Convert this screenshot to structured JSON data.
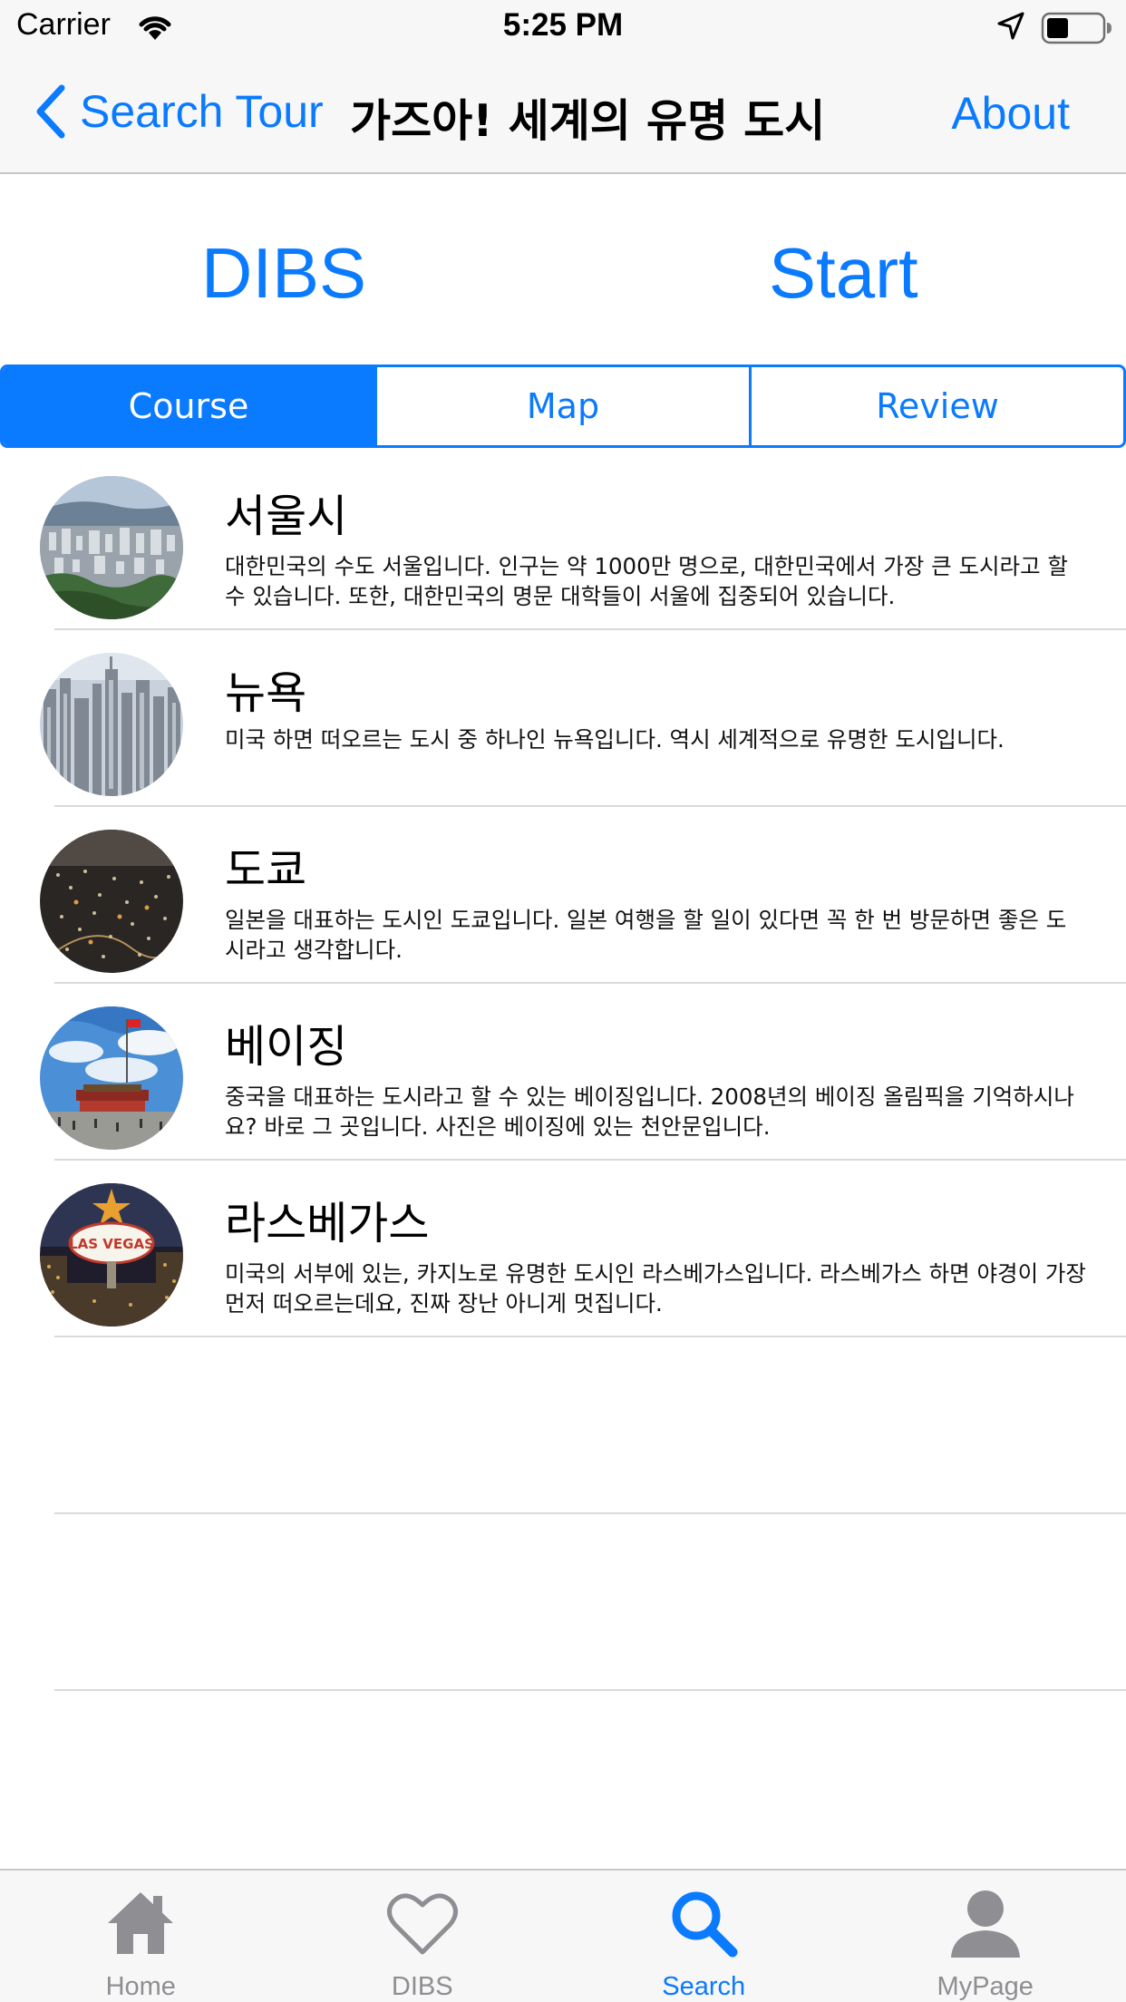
{
  "status_bar": {
    "carrier": "Carrier",
    "time": "5:25 PM",
    "icons": [
      "wifi-icon",
      "location-arrow-icon",
      "battery-icon"
    ]
  },
  "nav": {
    "back_label": "Search Tour",
    "title": "가즈아! 세계의 유명 도시",
    "right_label": "About",
    "tint_color": "#0a7aff"
  },
  "actions": {
    "dibs_label": "DIBS",
    "start_label": "Start"
  },
  "segments": [
    {
      "label": "Course",
      "selected": true
    },
    {
      "label": "Map",
      "selected": false
    },
    {
      "label": "Review",
      "selected": false
    }
  ],
  "cities": [
    {
      "name": "서울시",
      "description": "대한민국의 수도 서울입니다. 인구는 약 1000만 명으로, 대한민국에서 가장 큰 도시라고 할 수 있습니다. 또한, 대한민국의 명문 대학들이 서울에 집중되어 있습니다."
    },
    {
      "name": "뉴욕",
      "description": "미국 하면 떠오르는 도시 중 하나인 뉴욕입니다. 역시 세계적으로 유명한 도시입니다."
    },
    {
      "name": "도쿄",
      "description": "일본을 대표하는 도시인 도쿄입니다. 일본 여행을 할 일이 있다면 꼭 한 번 방문하면 좋은 도시라고 생각합니다."
    },
    {
      "name": "베이징",
      "description": "중국을 대표하는 도시라고 할 수 있는 베이징입니다. 2008년의 베이징 올림픽을 기억하시나요? 바로 그 곳입니다. 사진은 베이징에 있는 천안문입니다."
    },
    {
      "name": "라스베가스",
      "description": "미국의 서부에 있는, 카지노로 유명한 도시인 라스베가스입니다. 라스베가스 하면 야경이 가장 먼저 떠오르는데요, 진짜 장난 아니게 멋집니다.",
      "sign_text": "LAS VEGAS"
    }
  ],
  "tabs": [
    {
      "label": "Home",
      "icon": "house-icon",
      "active": false
    },
    {
      "label": "DIBS",
      "icon": "heart-icon",
      "active": false
    },
    {
      "label": "Search",
      "icon": "magnifier-icon",
      "active": true
    },
    {
      "label": "MyPage",
      "icon": "person-icon",
      "active": false
    }
  ]
}
